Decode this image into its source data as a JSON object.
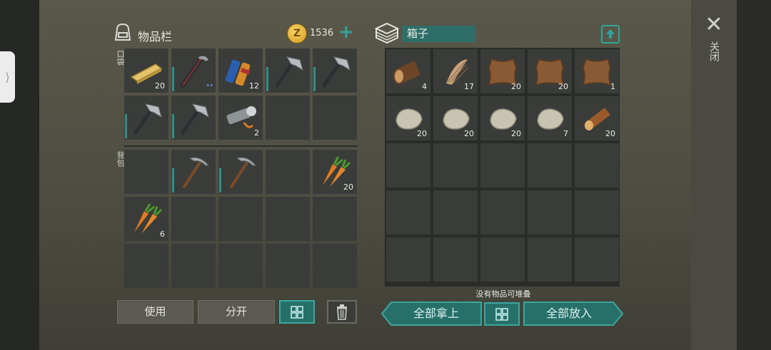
{
  "side_tab": {
    "glyph": "⟩"
  },
  "close": {
    "glyph": "✕",
    "label": "关闭"
  },
  "inventory": {
    "title": "物品栏",
    "coins": "1536",
    "coin_symbol": "Z",
    "plus": "+",
    "pocket_label": "口袋",
    "backpack_label": "背包",
    "pocket_slots": [
      {
        "item": "wood-plank",
        "qty": "20"
      },
      {
        "item": "crowbar",
        "qty": "",
        "dots": "••",
        "dur": true
      },
      {
        "item": "batteries",
        "qty": "12"
      },
      {
        "item": "hatchet",
        "qty": "",
        "dur": true
      },
      {
        "item": "hatchet",
        "qty": "",
        "dur": true
      },
      {
        "item": "hatchet",
        "qty": "",
        "dur": true
      },
      {
        "item": "hatchet",
        "qty": "",
        "dur": true
      },
      {
        "item": "flashlight",
        "qty": "2"
      },
      {
        "item": "empty",
        "qty": ""
      },
      {
        "item": "empty",
        "qty": ""
      }
    ],
    "backpack_slots": [
      {
        "item": "empty",
        "qty": ""
      },
      {
        "item": "pickaxe",
        "qty": "",
        "dur": true
      },
      {
        "item": "pickaxe",
        "qty": "",
        "dur": true
      },
      {
        "item": "empty",
        "qty": ""
      },
      {
        "item": "carrots",
        "qty": "20"
      },
      {
        "item": "carrots",
        "qty": "6"
      },
      {
        "item": "empty",
        "qty": ""
      },
      {
        "item": "empty",
        "qty": ""
      },
      {
        "item": "empty",
        "qty": ""
      },
      {
        "item": "empty",
        "qty": ""
      },
      {
        "item": "empty",
        "qty": ""
      },
      {
        "item": "empty",
        "qty": ""
      },
      {
        "item": "empty",
        "qty": ""
      },
      {
        "item": "empty",
        "qty": ""
      },
      {
        "item": "empty",
        "qty": ""
      }
    ],
    "buttons": {
      "use": "使用",
      "split": "分开"
    }
  },
  "crate": {
    "title": "箱子",
    "slots": [
      {
        "item": "log",
        "qty": "4"
      },
      {
        "item": "fiber",
        "qty": "17"
      },
      {
        "item": "leather",
        "qty": "20"
      },
      {
        "item": "leather",
        "qty": "20"
      },
      {
        "item": "leather",
        "qty": "1"
      },
      {
        "item": "stone",
        "qty": "20"
      },
      {
        "item": "stone",
        "qty": "20"
      },
      {
        "item": "stone",
        "qty": "20"
      },
      {
        "item": "stone",
        "qty": "7"
      },
      {
        "item": "wood-log",
        "qty": "20"
      },
      {
        "item": "empty",
        "qty": ""
      },
      {
        "item": "empty",
        "qty": ""
      },
      {
        "item": "empty",
        "qty": ""
      },
      {
        "item": "empty",
        "qty": ""
      },
      {
        "item": "empty",
        "qty": ""
      },
      {
        "item": "empty",
        "qty": ""
      },
      {
        "item": "empty",
        "qty": ""
      },
      {
        "item": "empty",
        "qty": ""
      },
      {
        "item": "empty",
        "qty": ""
      },
      {
        "item": "empty",
        "qty": ""
      },
      {
        "item": "empty",
        "qty": ""
      },
      {
        "item": "empty",
        "qty": ""
      },
      {
        "item": "empty",
        "qty": ""
      },
      {
        "item": "empty",
        "qty": ""
      },
      {
        "item": "empty",
        "qty": ""
      }
    ],
    "hint": "没有物品可堆叠",
    "buttons": {
      "take_all": "全部拿上",
      "put_all": "全部放入"
    }
  },
  "colors": {
    "accent": "#2fa69b",
    "slot": "#3a3c3a"
  }
}
